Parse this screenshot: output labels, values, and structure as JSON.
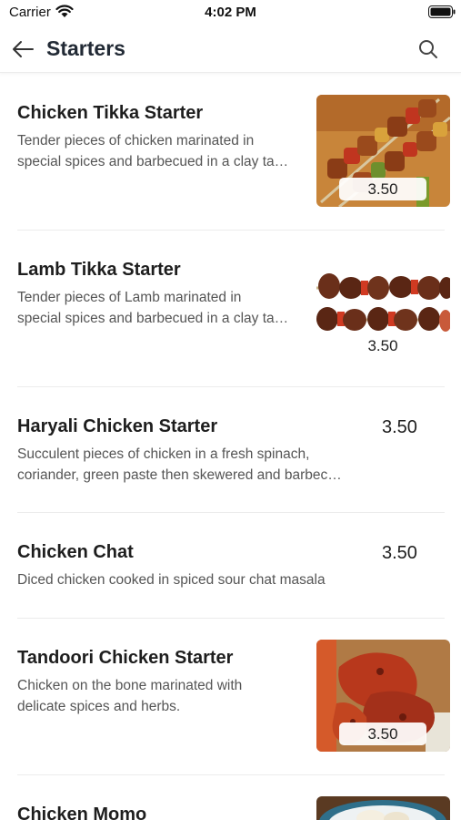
{
  "status_bar": {
    "carrier": "Carrier",
    "time": "4:02 PM"
  },
  "nav": {
    "title": "Starters"
  },
  "items": [
    {
      "title": "Chicken Tikka Starter",
      "desc1": "Tender pieces of chicken marinated in",
      "desc2": "special spices and barbecued in a clay ta…",
      "price": "3.50",
      "image": "chicken-tikka-skewers"
    },
    {
      "title": "Lamb Tikka Starter",
      "desc1": "Tender pieces of Lamb marinated in",
      "desc2": "special spices and barbecued in a clay ta…",
      "price": "3.50",
      "image": "lamb-tikka-skewers"
    },
    {
      "title": "Haryali Chicken Starter",
      "desc1": "Succulent pieces of chicken in a fresh spinach,",
      "desc2": "coriander, green paste then skewered and barbec…",
      "price": "3.50"
    },
    {
      "title": "Chicken Chat",
      "desc1": "Diced chicken cooked in spiced sour chat masala",
      "price": "3.50"
    },
    {
      "title": "Tandoori Chicken Starter",
      "desc1": "Chicken on the bone marinated with",
      "desc2": "delicate spices and herbs.",
      "price": "3.50",
      "image": "tandoori-chicken"
    },
    {
      "title": "Chicken Momo",
      "image": "chicken-momo-bowl"
    }
  ]
}
